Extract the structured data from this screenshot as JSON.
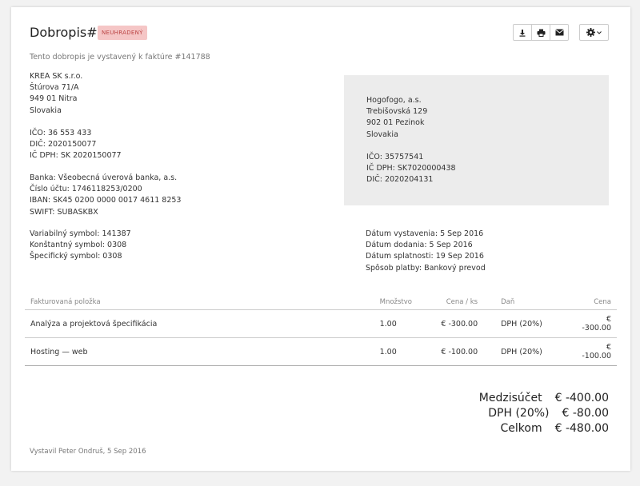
{
  "header": {
    "title": "Dobropis#1",
    "status_badge": "NEUHRADENÝ",
    "subtitle": "Tento dobropis je vystavený k faktúre #141788"
  },
  "toolbar": {
    "icons": [
      "download-icon",
      "print-icon",
      "email-icon",
      "gear-icon"
    ]
  },
  "supplier": {
    "name": "KREA SK s.r.o.",
    "street": "Štúrova 71/A",
    "city": "949 01 Nitra",
    "country": "Slovakia",
    "ico": "IČO: 36 553 433",
    "dic": "DIČ: 2020150077",
    "ic_dph": "IČ DPH: SK 2020150077",
    "bank": "Banka: Všeobecná úverová banka, a.s.",
    "account": "Číslo účtu: 1746118253/0200",
    "iban": "IBAN: SK45 0200 0000 0017 4611 8253",
    "swift": "SWIFT: SUBASKBX",
    "variable_symbol": "Variabilný symbol: 141387",
    "constant_symbol": "Konštantný symbol: 0308",
    "specific_symbol": "Špecifický symbol: 0308"
  },
  "client": {
    "name": "Hogofogo, a.s.",
    "street": "Trebišovská 129",
    "city": "902 01 Pezinok",
    "country": "Slovakia",
    "ico": "IČO: 35757541",
    "ic_dph": "IČ DPH: SK7020000438",
    "dic": "DIČ: 2020204131"
  },
  "dates": {
    "issued": "Dátum vystavenia: 5 Sep 2016",
    "delivered": "Dátum dodania: 5 Sep 2016",
    "due": "Dátum splatnosti: 19 Sep 2016",
    "payment": "Spôsob platby: Bankový prevod"
  },
  "items_table": {
    "headers": {
      "item": "Fakturovaná položka",
      "qty": "Množstvo",
      "unit_price": "Cena / ks",
      "tax": "Daň",
      "price": "Cena"
    },
    "rows": [
      {
        "item": "Analýza a projektová špecifikácia",
        "qty": "1.00",
        "unit_price": "€ -300.00",
        "tax": "DPH (20%)",
        "price": "€ -300.00"
      },
      {
        "item": "Hosting — web",
        "qty": "1.00",
        "unit_price": "€ -100.00",
        "tax": "DPH (20%)",
        "price": "€ -100.00"
      }
    ]
  },
  "totals": {
    "subtotal_label": "Medzisúčet",
    "subtotal_value": "€ -400.00",
    "tax_label": "DPH (20%)",
    "tax_value": "€ -80.00",
    "total_label": "Celkom",
    "total_value": "€ -480.00"
  },
  "footer": {
    "issued_by": "Vystavil Peter Ondruš, 5 Sep 2016"
  }
}
